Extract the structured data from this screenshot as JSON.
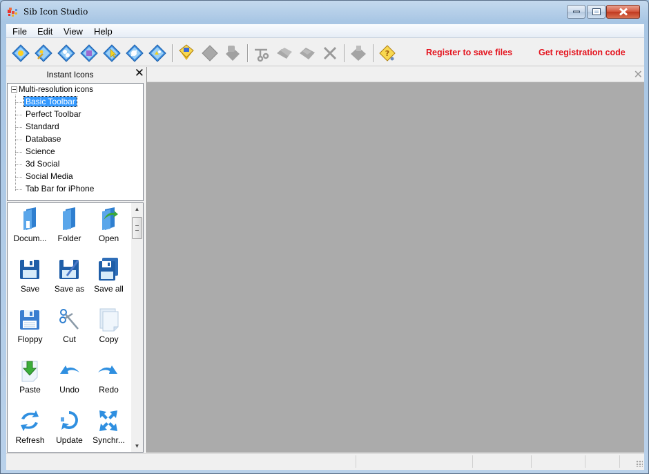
{
  "window": {
    "title": "Sib Icon Studio",
    "controls": {
      "minimize": "minimize",
      "maximize": "maximize",
      "close": "close"
    }
  },
  "menubar": {
    "items": [
      {
        "label": "File"
      },
      {
        "label": "Edit"
      },
      {
        "label": "View"
      },
      {
        "label": "Help"
      }
    ]
  },
  "toolbar": {
    "groups": [
      [
        "new-icon",
        "new-from-image",
        "new-icon-library",
        "new-from-screenshot",
        "new-cursor",
        "new-animated-cursor",
        "new-from-folder"
      ],
      [
        "open-file",
        "save-file",
        "save-as-file"
      ],
      [
        "cut",
        "copy",
        "paste",
        "delete"
      ],
      [
        "print"
      ],
      [
        "help"
      ]
    ],
    "links": [
      {
        "label": "Register to save files"
      },
      {
        "label": "Get registration code"
      }
    ],
    "link_color": "#e4141e"
  },
  "instant_icons": {
    "title": "Instant Icons",
    "tree": {
      "root": "Multi-resolution icons",
      "expanded": true,
      "children": [
        {
          "label": "Basic Toolbar",
          "selected": true
        },
        {
          "label": "Perfect Toolbar"
        },
        {
          "label": "Standard"
        },
        {
          "label": "Database"
        },
        {
          "label": "Science"
        },
        {
          "label": "3d Social"
        },
        {
          "label": "Social Media"
        },
        {
          "label": "Tab Bar for iPhone"
        }
      ]
    },
    "gallery": [
      {
        "label": "Docum...",
        "icon": "document-folder"
      },
      {
        "label": "Folder",
        "icon": "folder"
      },
      {
        "label": "Open",
        "icon": "open-folder"
      },
      {
        "label": "Save",
        "icon": "save"
      },
      {
        "label": "Save as",
        "icon": "save-as"
      },
      {
        "label": "Save all",
        "icon": "save-all"
      },
      {
        "label": "Floppy",
        "icon": "floppy"
      },
      {
        "label": "Cut",
        "icon": "scissors"
      },
      {
        "label": "Copy",
        "icon": "copy"
      },
      {
        "label": "Paste",
        "icon": "paste"
      },
      {
        "label": "Undo",
        "icon": "undo"
      },
      {
        "label": "Redo",
        "icon": "redo"
      },
      {
        "label": "Refresh",
        "icon": "refresh"
      },
      {
        "label": "Update",
        "icon": "update"
      },
      {
        "label": "Synchr...",
        "icon": "synchronize"
      }
    ]
  },
  "colors": {
    "selection": "#3399ff",
    "workspace": "#ababab",
    "icon_blue": "#2f7fd0"
  }
}
